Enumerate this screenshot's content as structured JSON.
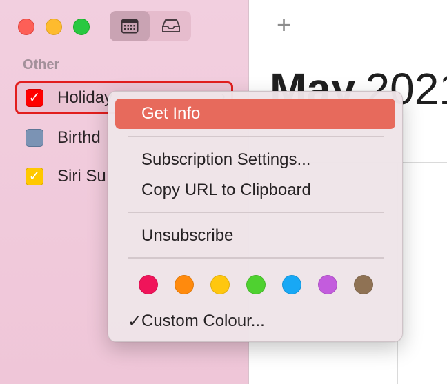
{
  "window": {
    "traffic_lights": {
      "close_color": "#fd5f57",
      "minimize_color": "#febb2e",
      "maximize_color": "#28c840"
    }
  },
  "toolbar": {
    "calendar_icon": "calendar-icon",
    "inbox_icon": "inbox-icon",
    "add_label": "+"
  },
  "sidebar": {
    "section_label": "Other",
    "calendars": [
      {
        "name": "Holiday",
        "color": "#ff0000",
        "checked": true,
        "selected": true
      },
      {
        "name": "Birthd",
        "color": "#7b93b4",
        "checked": false,
        "selected": false
      },
      {
        "name": "Siri Su",
        "color": "#ffc800",
        "checked": true,
        "selected": false
      }
    ]
  },
  "main": {
    "month": "May",
    "year": "2021"
  },
  "context_menu": {
    "items": [
      {
        "label": "Get Info",
        "highlighted": true
      },
      {
        "label": "Subscription Settings..."
      },
      {
        "label": "Copy URL to Clipboard"
      },
      {
        "label": "Unsubscribe"
      }
    ],
    "colors": [
      "#f0145a",
      "#ff8a0d",
      "#ffc70f",
      "#4fd130",
      "#18a8f5",
      "#c35cdd",
      "#8f7254"
    ],
    "custom_colour_label": "Custom Colour...",
    "custom_colour_checked": true,
    "accent_highlight": "#e76a5c"
  }
}
